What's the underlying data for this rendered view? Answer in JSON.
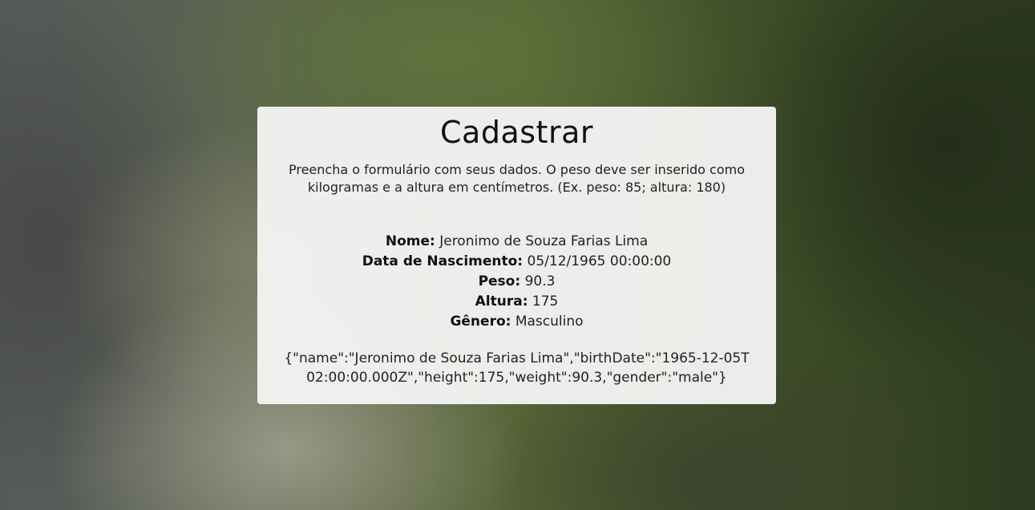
{
  "card": {
    "title": "Cadastrar",
    "description": "Preencha o formulário com seus dados. O peso deve ser inserido como kilogramas e a altura em centímetros. (Ex. peso: 85; altura: 180)",
    "fields": [
      {
        "label": "Nome:",
        "value": "Jeronimo de Souza Farias Lima"
      },
      {
        "label": "Data de Nascimento:",
        "value": "05/12/1965 00:00:00"
      },
      {
        "label": "Peso:",
        "value": "90.3"
      },
      {
        "label": "Altura:",
        "value": "175"
      },
      {
        "label": "Gênero:",
        "value": "Masculino"
      }
    ],
    "json_output": "{\"name\":\"Jeronimo de Souza Farias Lima\",\"birthDate\":\"1965-12-05T02:00:00.000Z\",\"height\":175,\"weight\":90.3,\"gender\":\"male\"}"
  }
}
